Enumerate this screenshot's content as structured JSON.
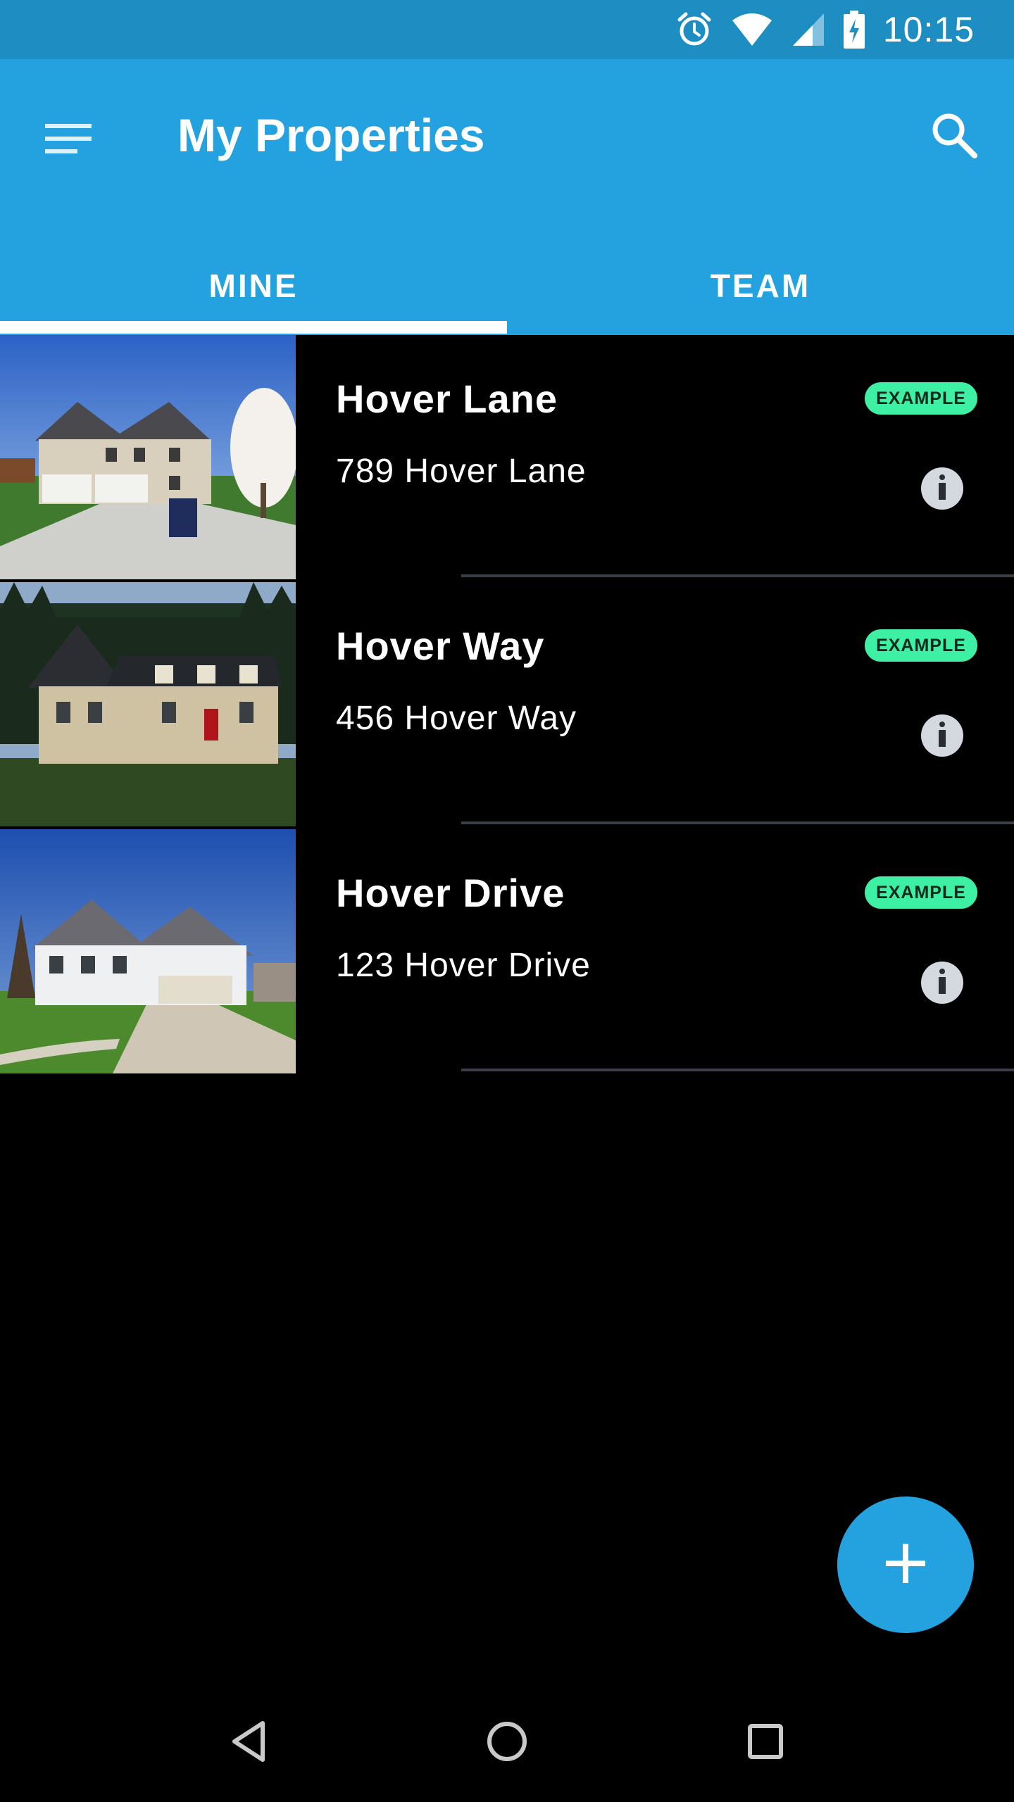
{
  "status_bar": {
    "time": "10:15",
    "icons": [
      "alarm-icon",
      "wifi-icon",
      "signal-icon",
      "battery-charging-icon"
    ]
  },
  "app_bar": {
    "title": "My Properties",
    "menu_icon": "menu-icon",
    "search_icon": "search-icon"
  },
  "tabs": [
    {
      "label": "MINE",
      "selected": true
    },
    {
      "label": "TEAM",
      "selected": false
    }
  ],
  "properties": [
    {
      "name": "Hover Lane",
      "address": "789 Hover Lane",
      "badge": "EXAMPLE"
    },
    {
      "name": "Hover Way",
      "address": "456 Hover Way",
      "badge": "EXAMPLE"
    },
    {
      "name": "Hover Drive",
      "address": "123 Hover Drive",
      "badge": "EXAMPLE"
    }
  ],
  "fab": {
    "icon": "add-icon"
  },
  "nav_bar": {
    "icons": [
      "back-icon",
      "home-icon",
      "recents-icon"
    ]
  },
  "colors": {
    "status_bar": "#1d8dc2",
    "app_bar": "#23a2df",
    "badge": "#3df0a3",
    "background": "#000000"
  }
}
